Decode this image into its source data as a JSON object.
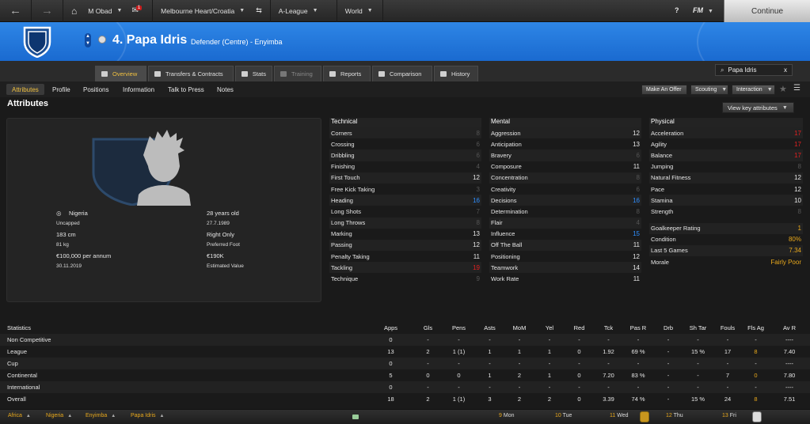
{
  "topbar": {
    "manager": "M Obad",
    "notifications": "1",
    "club": "Melbourne Heart/Croatia",
    "league": "A-League",
    "world": "World",
    "help": "?",
    "fm": "FM",
    "continue": "Continue"
  },
  "player": {
    "name": "4. Papa Idris",
    "subtitle": "Defender (Centre) - Enyimba"
  },
  "tabs": [
    "Overview",
    "Transfers & Contracts",
    "Stats",
    "Training",
    "Reports",
    "Comparison",
    "History"
  ],
  "search": {
    "value": "Papa Idris",
    "clear": "x"
  },
  "subtabs": [
    "Attributes",
    "Profile",
    "Positions",
    "Information",
    "Talk to Press",
    "Notes"
  ],
  "actions": {
    "offer": "Make An Offer",
    "scouting": "Scouting",
    "interaction": "Interaction"
  },
  "section_title": "Attributes",
  "view_key_attributes": "View key attributes",
  "profile": {
    "nation": "Nigeria",
    "caps": "Uncapped",
    "height": "183 cm",
    "weight": "81 kg",
    "wage": "€100,000 per annum",
    "contract_end": "30.11.2019",
    "age": "28 years old",
    "dob": "27.7.1989",
    "foot": "Right Only",
    "foot_label": "Preferred Foot",
    "value": "€190K",
    "value_label": "Estimated Value"
  },
  "technical": {
    "title": "Technical",
    "rows": [
      {
        "name": "Corners",
        "value": "8",
        "cls": "dim"
      },
      {
        "name": "Crossing",
        "value": "6",
        "cls": "dim"
      },
      {
        "name": "Dribbling",
        "value": "6",
        "cls": "dim"
      },
      {
        "name": "Finishing",
        "value": "4",
        "cls": "dim"
      },
      {
        "name": "First Touch",
        "value": "12",
        "cls": "norm"
      },
      {
        "name": "Free Kick Taking",
        "value": "3",
        "cls": "dim"
      },
      {
        "name": "Heading",
        "value": "16",
        "cls": "high"
      },
      {
        "name": "Long Shots",
        "value": "7",
        "cls": "dim"
      },
      {
        "name": "Long Throws",
        "value": "8",
        "cls": "dim"
      },
      {
        "name": "Marking",
        "value": "13",
        "cls": "norm"
      },
      {
        "name": "Passing",
        "value": "12",
        "cls": "norm"
      },
      {
        "name": "Penalty Taking",
        "value": "11",
        "cls": "norm"
      },
      {
        "name": "Tackling",
        "value": "19",
        "cls": "red"
      },
      {
        "name": "Technique",
        "value": "9",
        "cls": "dim"
      }
    ]
  },
  "mental": {
    "title": "Mental",
    "rows": [
      {
        "name": "Aggression",
        "value": "12",
        "cls": "norm"
      },
      {
        "name": "Anticipation",
        "value": "13",
        "cls": "norm"
      },
      {
        "name": "Bravery",
        "value": "6",
        "cls": "dim"
      },
      {
        "name": "Composure",
        "value": "11",
        "cls": "norm"
      },
      {
        "name": "Concentration",
        "value": "8",
        "cls": "dim"
      },
      {
        "name": "Creativity",
        "value": "6",
        "cls": "dim"
      },
      {
        "name": "Decisions",
        "value": "16",
        "cls": "high"
      },
      {
        "name": "Determination",
        "value": "8",
        "cls": "dim"
      },
      {
        "name": "Flair",
        "value": "4",
        "cls": "dim"
      },
      {
        "name": "Influence",
        "value": "15",
        "cls": "high"
      },
      {
        "name": "Off The Ball",
        "value": "11",
        "cls": "norm"
      },
      {
        "name": "Positioning",
        "value": "12",
        "cls": "norm"
      },
      {
        "name": "Teamwork",
        "value": "14",
        "cls": "norm"
      },
      {
        "name": "Work Rate",
        "value": "11",
        "cls": "norm"
      }
    ]
  },
  "physical": {
    "title": "Physical",
    "rows": [
      {
        "name": "Acceleration",
        "value": "17",
        "cls": "red"
      },
      {
        "name": "Agility",
        "value": "17",
        "cls": "red"
      },
      {
        "name": "Balance",
        "value": "17",
        "cls": "red"
      },
      {
        "name": "Jumping",
        "value": "8",
        "cls": "dim"
      },
      {
        "name": "Natural Fitness",
        "value": "12",
        "cls": "norm"
      },
      {
        "name": "Pace",
        "value": "12",
        "cls": "norm"
      },
      {
        "name": "Stamina",
        "value": "10",
        "cls": "norm"
      },
      {
        "name": "Strength",
        "value": "8",
        "cls": "dim"
      }
    ],
    "extra": [
      {
        "name": "Goalkeeper Rating",
        "value": "1",
        "cls": "yellow"
      },
      {
        "name": "Condition",
        "value": "80%",
        "cls": "yellow"
      },
      {
        "name": "Last 5 Games",
        "value": "7.34",
        "cls": "yellow"
      },
      {
        "name": "Morale",
        "value": "Fairly Poor",
        "cls": "yellow"
      }
    ]
  },
  "statistics": {
    "title": "Statistics",
    "columns": [
      "Apps",
      "Gls",
      "Pens",
      "Asts",
      "MoM",
      "Yel",
      "Red",
      "Tck",
      "Pas R",
      "Drb",
      "Sh Tar",
      "Fouls",
      "Fls Ag",
      "Av R"
    ],
    "rows": [
      {
        "label": "Non Competitive",
        "cells": [
          "0",
          "-",
          "-",
          "-",
          "-",
          "-",
          "-",
          "-",
          "-",
          "-",
          "-",
          "-",
          "-",
          "----"
        ]
      },
      {
        "label": "League",
        "cells": [
          "13",
          "2",
          "1 (1)",
          "1",
          "1",
          "1",
          "0",
          "1.92",
          "69 %",
          "-",
          "15 %",
          "17",
          "8",
          "7.40"
        ]
      },
      {
        "label": "Cup",
        "cells": [
          "0",
          "-",
          "-",
          "-",
          "-",
          "-",
          "-",
          "-",
          "-",
          "-",
          "-",
          "-",
          "-",
          "----"
        ]
      },
      {
        "label": "Continental",
        "cells": [
          "5",
          "0",
          "0",
          "1",
          "2",
          "1",
          "0",
          "7.20",
          "83 %",
          "-",
          "-",
          "7",
          "0",
          "7.80"
        ]
      },
      {
        "label": "International",
        "cells": [
          "0",
          "-",
          "-",
          "-",
          "-",
          "-",
          "-",
          "-",
          "-",
          "-",
          "-",
          "-",
          "-",
          "----"
        ]
      },
      {
        "label": "Overall",
        "cells": [
          "18",
          "2",
          "1 (1)",
          "3",
          "2",
          "2",
          "0",
          "3.39",
          "74 %",
          "-",
          "15 %",
          "24",
          "8",
          "7.51"
        ]
      }
    ]
  },
  "bottombar": {
    "crumbs": [
      "Africa",
      "Nigeria",
      "Enyimba",
      "Papa Idris"
    ],
    "days": [
      {
        "num": "9",
        "day": "Mon"
      },
      {
        "num": "10",
        "day": "Tue"
      },
      {
        "num": "11",
        "day": "Wed"
      },
      {
        "num": "12",
        "day": "Thu"
      },
      {
        "num": "13",
        "day": "Fri"
      }
    ]
  }
}
